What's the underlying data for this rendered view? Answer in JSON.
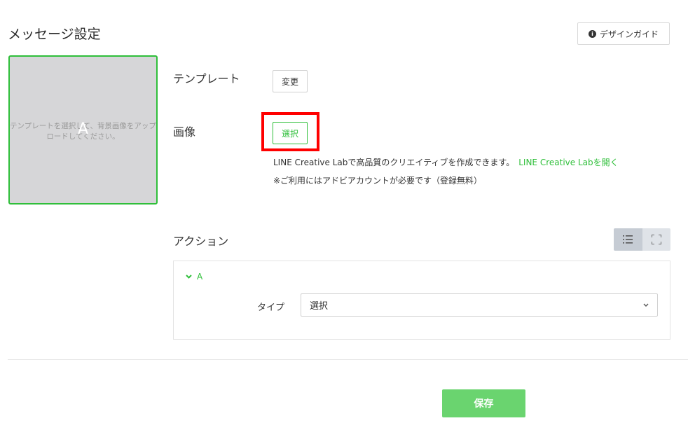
{
  "header": {
    "title": "メッセージ設定",
    "design_guide_label": "デザインガイド"
  },
  "preview": {
    "letter": "A",
    "placeholder_text": "テンプレートを選択して、背景画像をアップ\nロードしてください。"
  },
  "template_row": {
    "label": "テンプレート",
    "button_label": "変更"
  },
  "image_row": {
    "label": "画像",
    "button_label": "選択",
    "lab_text": "LINE Creative Labで高品質のクリエイティブを作成できます。",
    "lab_link": "LINE Creative Labを開く",
    "note": "※ご利用にはアドビアカウントが必要です（登録無料）"
  },
  "action": {
    "label": "アクション",
    "item_name": "A",
    "type_label": "タイプ",
    "type_value": "選択"
  },
  "footer": {
    "save_label": "保存"
  },
  "colors": {
    "accent": "#2fbf3a",
    "save": "#6ad46f",
    "highlight": "#ff0000"
  }
}
